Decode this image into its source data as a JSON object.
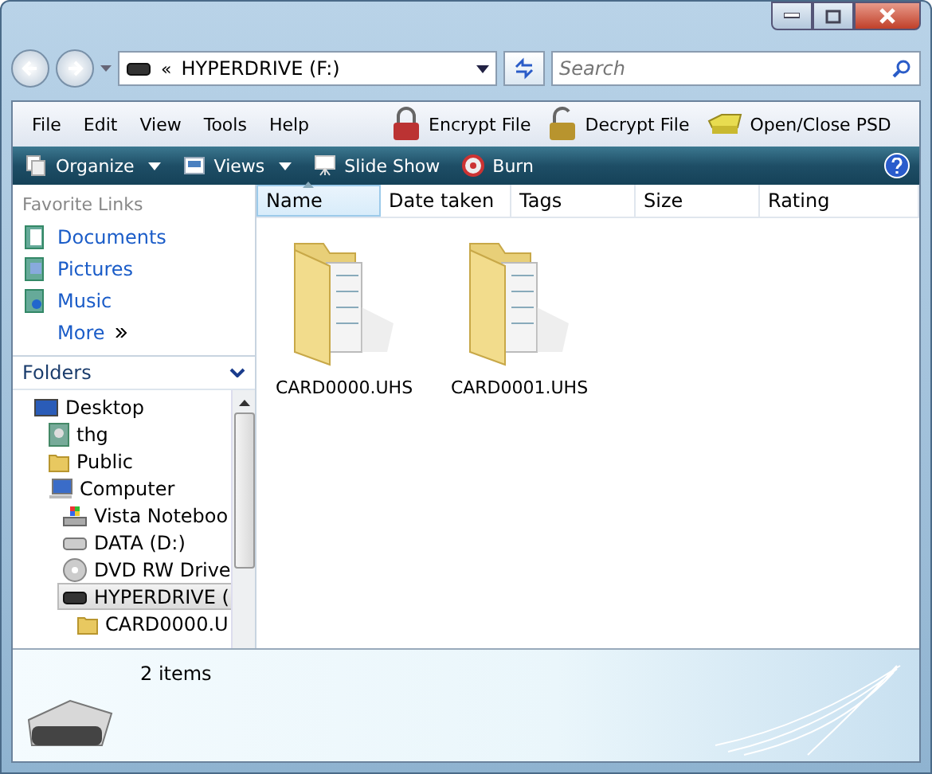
{
  "address": {
    "path": "HYPERDRIVE (F:)",
    "prefix": "«"
  },
  "search": {
    "placeholder": "Search"
  },
  "menu": [
    "File",
    "Edit",
    "View",
    "Tools",
    "Help"
  ],
  "commands": [
    {
      "label": "Encrypt File",
      "kind": "lock"
    },
    {
      "label": "Decrypt File",
      "kind": "unlock"
    },
    {
      "label": "Open/Close PSD",
      "kind": "psd"
    }
  ],
  "toolbar": [
    {
      "label": "Organize",
      "kind": "organize",
      "dropdown": true
    },
    {
      "label": "Views",
      "kind": "views",
      "dropdown": true
    },
    {
      "label": "Slide Show",
      "kind": "slideshow",
      "dropdown": false
    },
    {
      "label": "Burn",
      "kind": "burn",
      "dropdown": false
    }
  ],
  "favorites": {
    "title": "Favorite Links",
    "items": [
      {
        "label": "Documents",
        "kind": "documents"
      },
      {
        "label": "Pictures",
        "kind": "pictures"
      },
      {
        "label": "Music",
        "kind": "music"
      },
      {
        "label": "More",
        "kind": "more"
      }
    ]
  },
  "folders": {
    "title": "Folders",
    "tree": [
      {
        "label": "Desktop",
        "kind": "desktop",
        "selected": false,
        "children": [
          {
            "label": "thg",
            "kind": "user",
            "selected": false
          },
          {
            "label": "Public",
            "kind": "folder",
            "selected": false
          },
          {
            "label": "Computer",
            "kind": "computer",
            "selected": false,
            "children": [
              {
                "label": "Vista Noteboo",
                "kind": "windrive",
                "selected": false
              },
              {
                "label": "DATA (D:)",
                "kind": "drive",
                "selected": false
              },
              {
                "label": "DVD RW Drive",
                "kind": "dvd",
                "selected": false
              },
              {
                "label": "HYPERDRIVE (",
                "kind": "usb",
                "selected": true,
                "children": [
                  {
                    "label": "CARD0000.U",
                    "kind": "folder",
                    "selected": false
                  }
                ]
              }
            ]
          }
        ]
      }
    ]
  },
  "columns": [
    {
      "label": "Name",
      "sorted": true
    },
    {
      "label": "Date taken",
      "sorted": false
    },
    {
      "label": "Tags",
      "sorted": false
    },
    {
      "label": "Size",
      "sorted": false
    },
    {
      "label": "Rating",
      "sorted": false
    }
  ],
  "files": [
    {
      "name": "CARD0000.UHS"
    },
    {
      "name": "CARD0001.UHS"
    }
  ],
  "details": {
    "count": "2 items"
  }
}
